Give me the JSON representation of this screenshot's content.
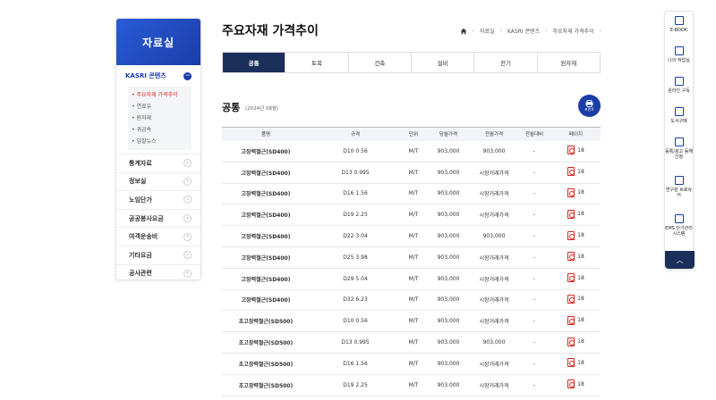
{
  "sidebar": {
    "header": "자료실",
    "section": "KASRI 콘텐츠",
    "sub_items": [
      {
        "label": "주요자재 가격추이",
        "active": true
      },
      {
        "label": "연료유",
        "active": false
      },
      {
        "label": "원자재",
        "active": false
      },
      {
        "label": "귀금속",
        "active": false
      },
      {
        "label": "입찰뉴스",
        "active": false
      }
    ],
    "items": [
      "통계자료",
      "정보실",
      "노임단가",
      "공공봉사요금",
      "여객운송비",
      "기타요금",
      "공사관련"
    ]
  },
  "page": {
    "title": "주요자재 가격추이",
    "breadcrumb": [
      "자료실",
      "KASRI 콘텐츠",
      "주요자재 가격추이"
    ]
  },
  "tabs": [
    {
      "label": "공통",
      "active": true
    },
    {
      "label": "토목",
      "active": false
    },
    {
      "label": "건축",
      "active": false
    },
    {
      "label": "설비",
      "active": false
    },
    {
      "label": "전기",
      "active": false
    },
    {
      "label": "원자재",
      "active": false
    }
  ],
  "section": {
    "title": "공통",
    "date": "(2024년 08월)",
    "print_label": "프린트"
  },
  "table": {
    "headers": [
      "품명",
      "규격",
      "단위",
      "당월가격",
      "전월가격",
      "전월대비",
      "페이지"
    ],
    "rows": [
      [
        "고장력철근(SD400)",
        "D10 0.56",
        "M/T",
        "903,000",
        "903,000",
        "-",
        "18"
      ],
      [
        "고장력철근(SD400)",
        "D13 0.995",
        "M/T",
        "903,000",
        "시장거래가격",
        "-",
        "18"
      ],
      [
        "고장력철근(SD400)",
        "D16 1.56",
        "M/T",
        "903,000",
        "시장거래가격",
        "-",
        "18"
      ],
      [
        "고장력철근(SD400)",
        "D19 2.25",
        "M/T",
        "903,000",
        "시장거래가격",
        "-",
        "18"
      ],
      [
        "고장력철근(SD400)",
        "D22 3.04",
        "M/T",
        "903,000",
        "903,000",
        "-",
        "18"
      ],
      [
        "고장력철근(SD400)",
        "D25 3.98",
        "M/T",
        "903,000",
        "시장거래가격",
        "-",
        "18"
      ],
      [
        "고장력철근(SD400)",
        "D29 5.04",
        "M/T",
        "903,000",
        "시장거래가격",
        "-",
        "18"
      ],
      [
        "고장력철근(SD400)",
        "D32 6.23",
        "M/T",
        "903,000",
        "시장거래가격",
        "-",
        "18"
      ],
      [
        "초고장력철근(SD500)",
        "D10 0.56",
        "M/T",
        "903,000",
        "시장거래가격",
        "-",
        "18"
      ],
      [
        "초고장력철근(SD500)",
        "D13 0.995",
        "M/T",
        "903,000",
        "903,000",
        "-",
        "18"
      ],
      [
        "초고장력철근(SD500)",
        "D16 1.56",
        "M/T",
        "903,000",
        "시장거래가격",
        "-",
        "18"
      ],
      [
        "초고장력철근(SD500)",
        "D19 2.25",
        "M/T",
        "903,000",
        "시장거래가격",
        "-",
        "18"
      ]
    ]
  },
  "quick_menu": [
    {
      "label": "E-BOOK",
      "icon": "building-icon"
    },
    {
      "label": "나의 작업실",
      "icon": "book-icon"
    },
    {
      "label": "온라인 구독",
      "icon": "laptop-icon"
    },
    {
      "label": "도서구매",
      "icon": "book-order-icon"
    },
    {
      "label": "등록/광고 동해신청",
      "icon": "edit-icon"
    },
    {
      "label": "연구원 브로슈어",
      "icon": "document-icon"
    },
    {
      "label": "EMS 단가관리 시스템",
      "icon": "monitor-icon"
    }
  ],
  "colors": {
    "brand": "#1a3da8",
    "tab_active": "#1a2f5a",
    "active_sub": "#d9261c"
  }
}
